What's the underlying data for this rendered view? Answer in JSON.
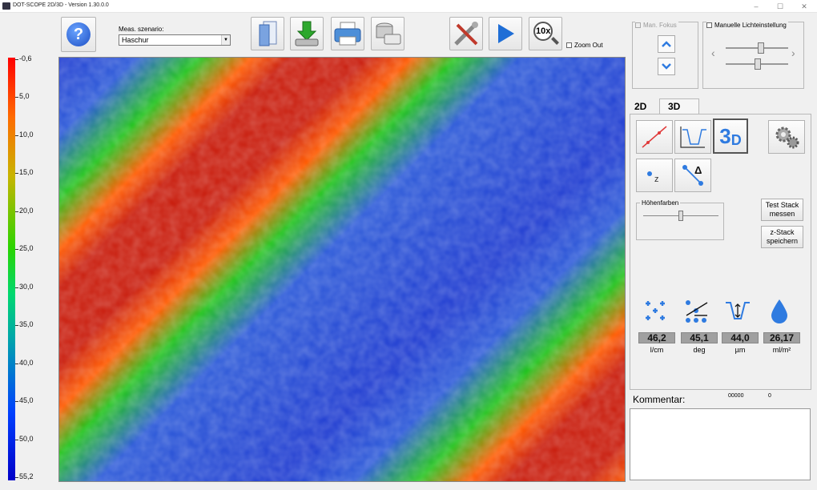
{
  "window": {
    "title": "DOT-SCOPE 2D/3D - Version 1.30.0.0",
    "min": "–",
    "max": "☐",
    "close": "✕"
  },
  "toolbar": {
    "meas_label": "Meas. szenario:",
    "meas_value": "Haschur",
    "help_label": "?",
    "zoom_label": "10x",
    "zoom_out_label": "Zoom Out"
  },
  "focus": {
    "man_focus_label": "Man. Fokus",
    "manual_light_label": "Manuelle Lichteinstellung"
  },
  "color_scale": {
    "labels": [
      "-0,6",
      "5,0",
      "10,0",
      "15,0",
      "20,0",
      "25,0",
      "30,0",
      "35,0",
      "40,0",
      "45,0",
      "50,0",
      "55,2"
    ]
  },
  "tabs": [
    {
      "label": "2D"
    },
    {
      "label": "3D"
    }
  ],
  "tools": {
    "hoehenfarben_label": "Höhenfarben",
    "three_d_label": "3",
    "three_d_sub": "D",
    "point_z_label": "z",
    "delta_label": "Δ",
    "test_stack": "Test Stack messen",
    "z_stack": "z-Stack speichern"
  },
  "measurements": [
    {
      "name": "line-density",
      "value": "46,2",
      "unit": "l/cm"
    },
    {
      "name": "angle",
      "value": "45,1",
      "unit": "deg"
    },
    {
      "name": "depth",
      "value": "44,0",
      "unit": "µm"
    },
    {
      "name": "volume",
      "value": "26,17",
      "unit": "ml/m²"
    }
  ],
  "comment": {
    "label": "Kommentar:",
    "counter_a": "00000",
    "counter_b": "0",
    "text": ""
  },
  "colors": {
    "accent_blue": "#2f7be0",
    "heat_red": "#c81a0a",
    "heat_green": "#1fc21a",
    "heat_blue": "#1d3ad0"
  }
}
